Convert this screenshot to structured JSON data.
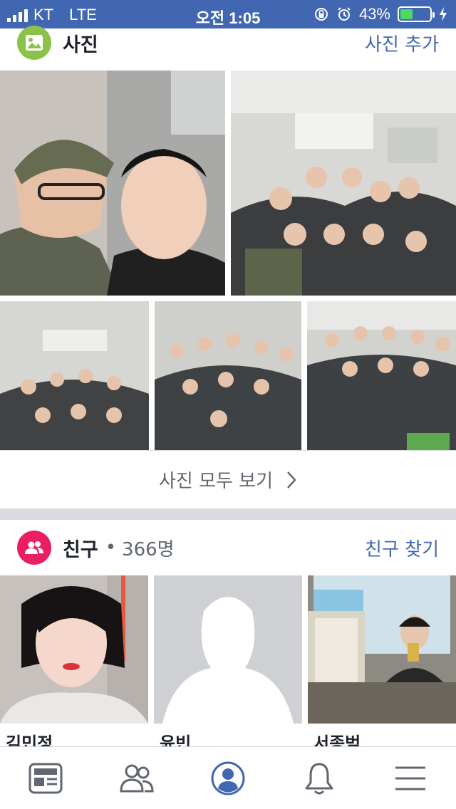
{
  "status_bar": {
    "carrier": "KT",
    "network": "LTE",
    "time": "오전 1:05",
    "battery": "43%",
    "battery_level": 0.43
  },
  "photos_section": {
    "title": "사진",
    "action": "사진 추가",
    "see_all": "사진 모두 보기",
    "icon": "photo-icon"
  },
  "friends_section": {
    "title": "친구",
    "separator": "•",
    "count": "366명",
    "action": "친구 찾기",
    "icon": "friends-icon",
    "friends": [
      {
        "name": "김민정"
      },
      {
        "name": "윤빈"
      },
      {
        "name": "서종범"
      }
    ]
  },
  "tab_bar": {
    "tabs": [
      "news-feed-icon",
      "friends-icon",
      "profile-icon",
      "notifications-icon",
      "menu-icon"
    ],
    "active": "profile-icon"
  },
  "colors": {
    "brand": "#4267b2",
    "photos_icon_bg": "#8bc34a",
    "friends_icon_bg": "#e91e63",
    "link": "#4267b2"
  }
}
